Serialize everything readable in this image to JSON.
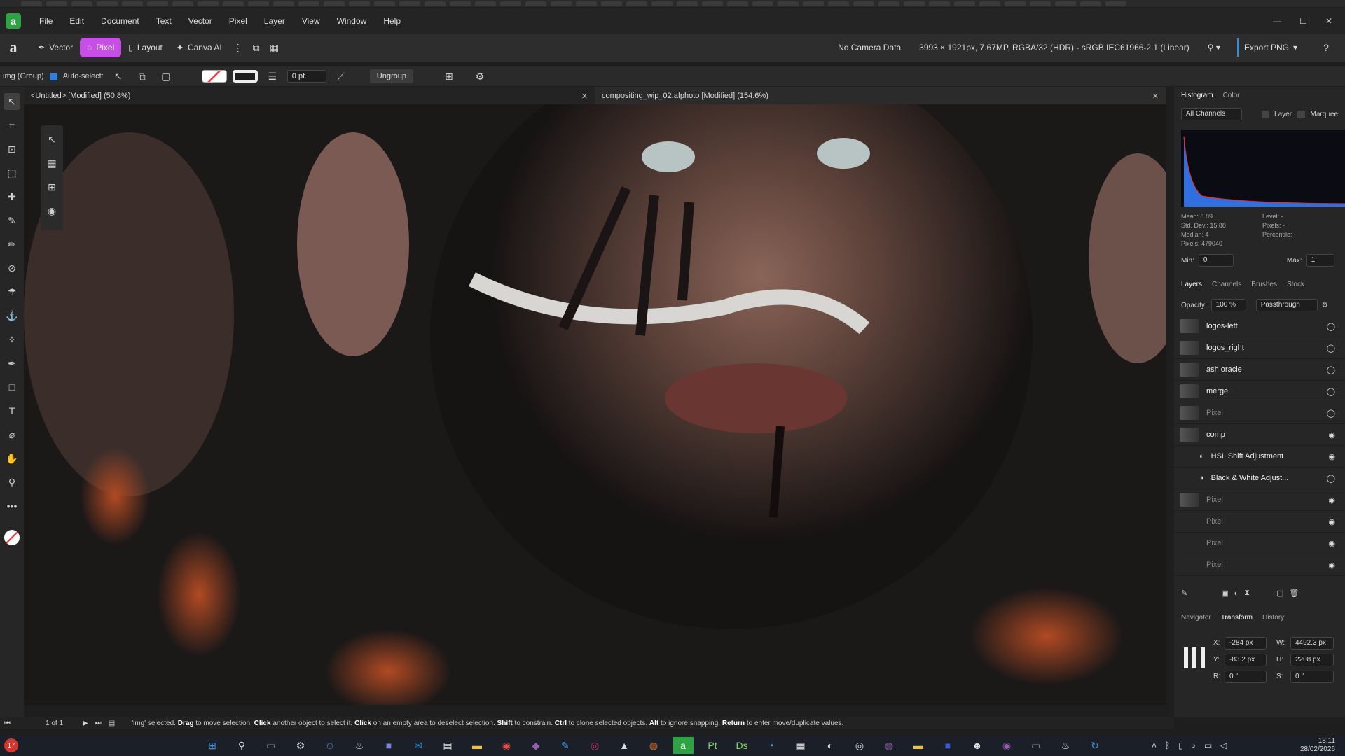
{
  "menubar": {
    "items": [
      "File",
      "Edit",
      "Document",
      "Text",
      "Vector",
      "Pixel",
      "Layer",
      "View",
      "Window",
      "Help"
    ]
  },
  "toolbar": {
    "personas": [
      {
        "label": "Vector",
        "active": false
      },
      {
        "label": "Pixel",
        "active": true
      },
      {
        "label": "Layout",
        "active": false
      },
      {
        "label": "Canva AI",
        "active": false
      }
    ],
    "camera": "No Camera Data",
    "doc_info": "3993 × 1921px, 7.67MP, RGBA/32 (HDR) - sRGB IEC61966-2.1 (Linear)",
    "export_label": "Export PNG"
  },
  "context": {
    "selection": "img (Group)",
    "autoselect": "Auto-select:",
    "stroke_width": "0 pt",
    "ungroup": "Ungroup"
  },
  "tabs": [
    {
      "title": "<Untitled> [Modified] (50.8%)"
    },
    {
      "title": "compositing_wip_02.afphoto [Modified] (154.6%)"
    }
  ],
  "histogram": {
    "tabs": [
      "Histogram",
      "Color"
    ],
    "channel": "All Channels",
    "layer_label": "Layer",
    "marquee_label": "Marquee",
    "stats": [
      "Mean: 8.89",
      "Std. Dev.: 15.88",
      "Median: 4",
      "Pixels: 479040"
    ],
    "stats_right": [
      "Level: -",
      "Pixels: -",
      "Percentile: -"
    ],
    "min_label": "Min:",
    "min_value": "0",
    "max_label": "Max:",
    "max_value": "1",
    "accent": "#2f6fe0"
  },
  "layers": {
    "tabs": [
      "Layers",
      "Channels",
      "Brushes",
      "Stock"
    ],
    "opacity_label": "Opacity:",
    "opacity_value": "100 %",
    "blend": "Passthrough",
    "items": [
      {
        "name": "logos-left",
        "visible": false
      },
      {
        "name": "logos_right",
        "visible": false
      },
      {
        "name": "ash oracle",
        "visible": false
      },
      {
        "name": "merge",
        "visible": false
      },
      {
        "name": "Pixel",
        "visible": false
      },
      {
        "name": "comp",
        "visible": true
      },
      {
        "name": "HSL Shift Adjustment",
        "visible": true
      },
      {
        "name": "Black & White Adjust...",
        "visible": false
      },
      {
        "name": "Pixel",
        "visible": true
      },
      {
        "name": "Pixel",
        "visible": true
      },
      {
        "name": "Pixel",
        "visible": true
      },
      {
        "name": "Pixel",
        "visible": true
      }
    ]
  },
  "transform": {
    "tabs": [
      "Navigator",
      "Transform",
      "History"
    ],
    "x_label": "X:",
    "x": "-284 px",
    "y_label": "Y:",
    "y": "-83.2 px",
    "w_label": "W:",
    "w": "4492.3 px",
    "h_label": "H:",
    "h": "2208 px",
    "r_label": "R:",
    "r": "0 °",
    "s_label": "S:",
    "s": "0 °"
  },
  "statusbar": {
    "page": "1 of 1",
    "message_parts": [
      "'img' selected. ",
      "Drag",
      " to move selection. ",
      "Click",
      " another object to select it. ",
      "Click",
      " on an empty area to deselect selection. ",
      "Shift",
      " to constrain. ",
      "Ctrl",
      " to clone selected objects. ",
      "Alt",
      " to ignore snapping. ",
      "Return",
      " to enter move/duplicate values."
    ]
  },
  "taskbar": {
    "time": "18:11",
    "date": "28/02/2026",
    "notification": "17"
  }
}
